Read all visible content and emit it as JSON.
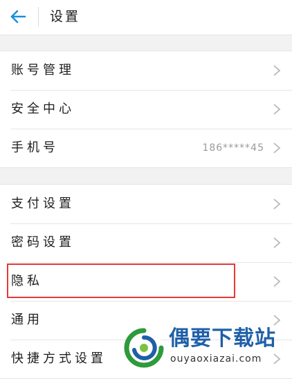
{
  "header": {
    "back_icon": "arrow-left-icon",
    "title": "设置",
    "accent": "#1a8fd8"
  },
  "groups": [
    {
      "items": [
        {
          "label": "账号管理",
          "value": ""
        },
        {
          "label": "安全中心",
          "value": ""
        },
        {
          "label": "手机号",
          "value": "186*****45"
        }
      ]
    },
    {
      "items": [
        {
          "label": "支付设置",
          "value": ""
        },
        {
          "label": "密码设置",
          "value": ""
        },
        {
          "label": "隐私",
          "value": "",
          "highlighted": true
        },
        {
          "label": "通用",
          "value": ""
        },
        {
          "label": "快捷方式设置",
          "value": ""
        }
      ]
    }
  ],
  "highlight_color": "#e53935",
  "watermark": {
    "name": "偶要下载站",
    "url": "ouyaoxiazai.com"
  }
}
